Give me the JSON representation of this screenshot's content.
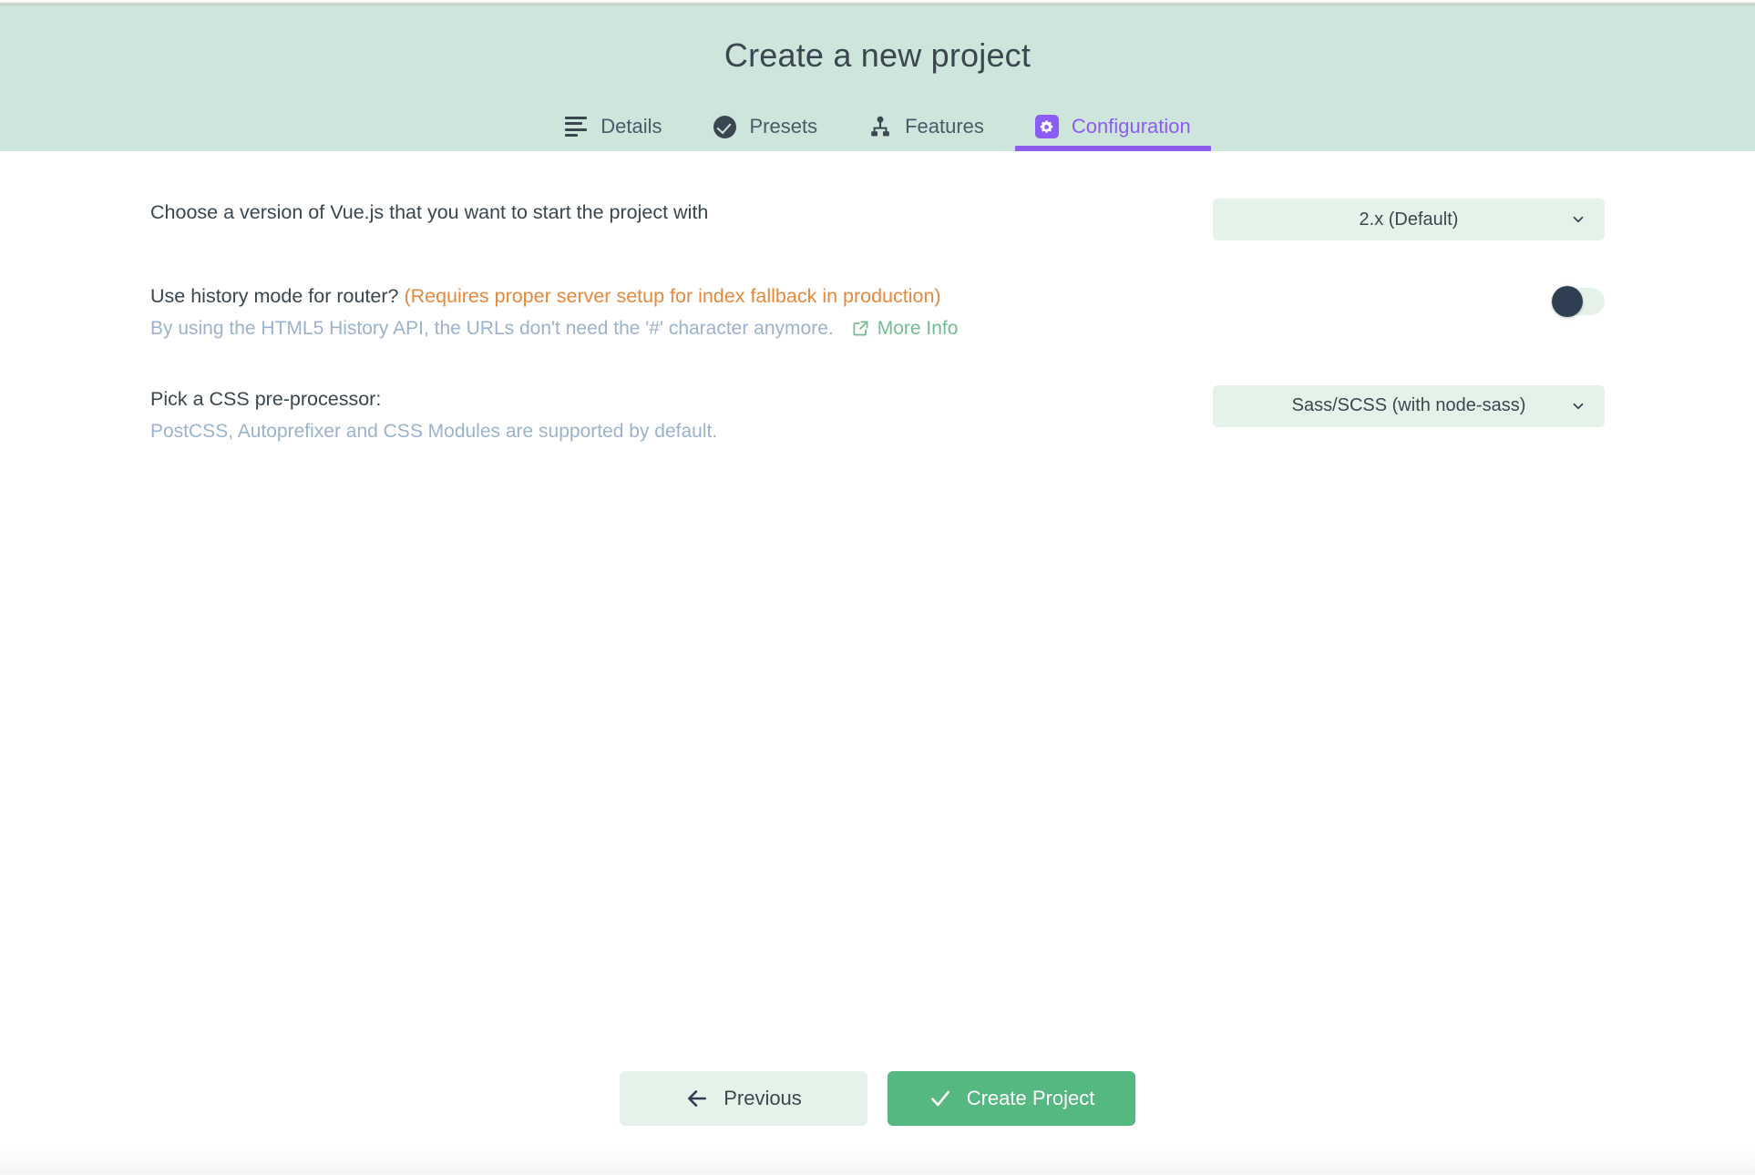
{
  "header": {
    "title": "Create a new project",
    "tabs": [
      {
        "label": "Details",
        "icon": "list-lines-icon",
        "active": false
      },
      {
        "label": "Presets",
        "icon": "check-circle-icon",
        "active": false
      },
      {
        "label": "Features",
        "icon": "sitemap-icon",
        "active": false
      },
      {
        "label": "Configuration",
        "icon": "gear-icon",
        "active": true
      }
    ]
  },
  "main": {
    "prompts": [
      {
        "question": "Choose a version of Vue.js that you want to start the project with",
        "warning": "",
        "description": "",
        "link_label": "",
        "control": "select",
        "value": "2.x (Default)"
      },
      {
        "question": "Use history mode for router?",
        "warning": "(Requires proper server setup for index fallback in production)",
        "description": "By using the HTML5 History API, the URLs don't need the '#' character anymore.",
        "link_label": "More Info",
        "control": "toggle",
        "value": "off"
      },
      {
        "question": "Pick a CSS pre-processor:",
        "warning": "",
        "description": "PostCSS, Autoprefixer and CSS Modules are supported by default.",
        "link_label": "",
        "control": "select",
        "value": "Sass/SCSS (with node-sass)"
      }
    ]
  },
  "footer": {
    "previous_label": "Previous",
    "create_label": "Create Project"
  },
  "colors": {
    "header_bg": "#cde5da",
    "accent_purple": "#8b5cf6",
    "accent_green": "#56b881",
    "warning_orange": "#e8883a",
    "muted_blue": "#9bb3cc",
    "control_bg": "#e5f2ea",
    "dark_navy": "#2f3e51"
  }
}
